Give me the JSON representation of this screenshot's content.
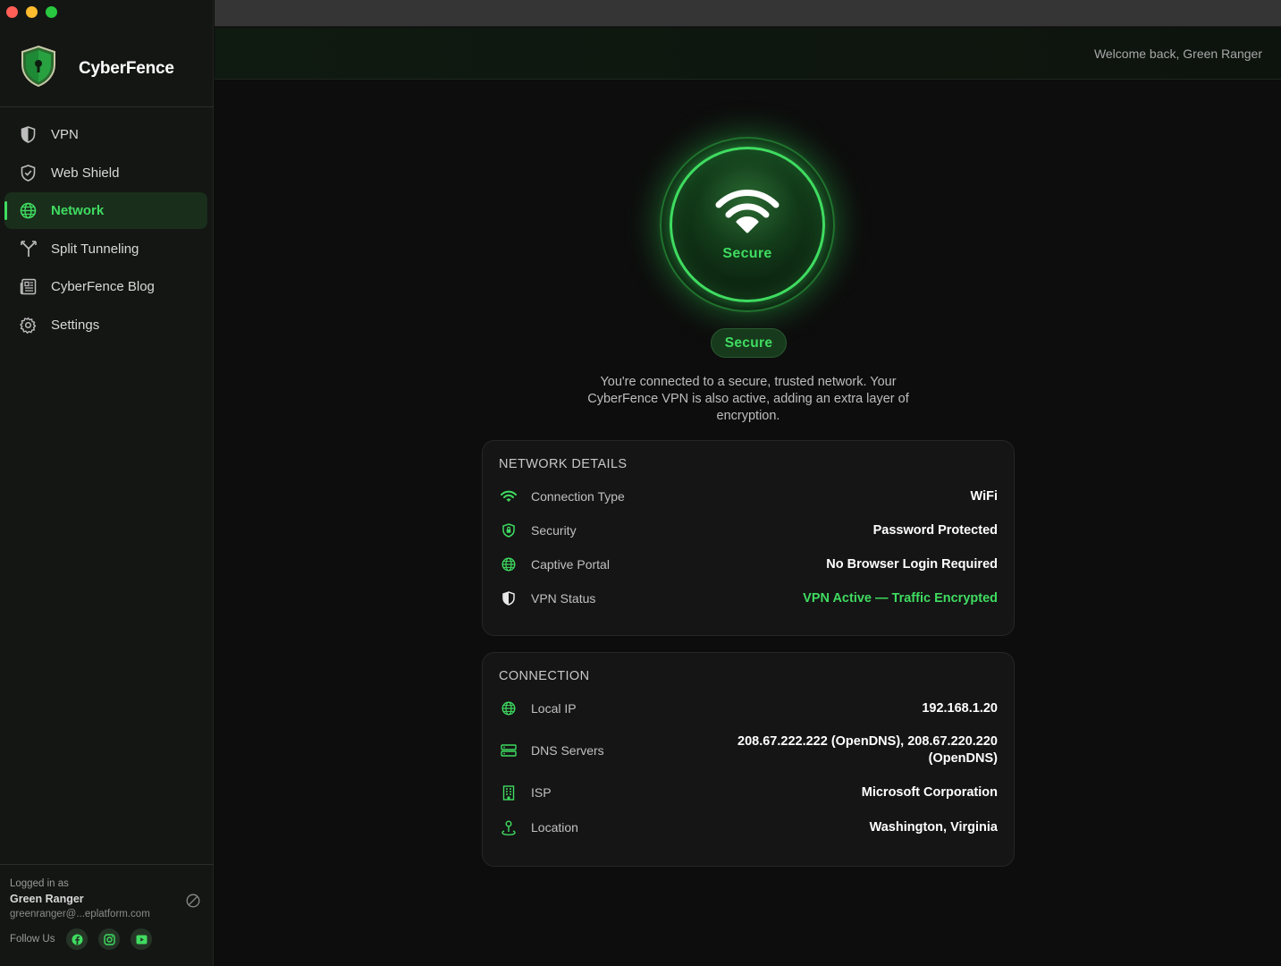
{
  "app": {
    "brand": "CyberFence"
  },
  "colors": {
    "accent": "#3fdc60",
    "background": "#0d0d0d",
    "sidebar": "#141614"
  },
  "sidebar": {
    "items": [
      {
        "label": "VPN",
        "icon": "half-shield-icon"
      },
      {
        "label": "Web Shield",
        "icon": "shield-check-icon"
      },
      {
        "label": "Network",
        "icon": "globe-icon",
        "active": true
      },
      {
        "label": "Split Tunneling",
        "icon": "split-arrow-icon"
      },
      {
        "label": "CyberFence Blog",
        "icon": "newspaper-icon"
      },
      {
        "label": "Settings",
        "icon": "gear-icon"
      }
    ],
    "footer": {
      "logged_label": "Logged in as",
      "user_name": "Green Ranger",
      "email": "greenranger@...eplatform.com",
      "follow_label": "Follow Us"
    }
  },
  "header": {
    "welcome": "Welcome back, Green Ranger"
  },
  "status": {
    "ring_label": "Secure",
    "pill_label": "Secure",
    "description": "You're connected to a secure, trusted network. Your CyberFence VPN is also active, adding an extra layer of encryption."
  },
  "network_details": {
    "title": "NETWORK DETAILS",
    "rows": [
      {
        "label": "Connection Type",
        "value": "WiFi",
        "icon": "wifi-icon"
      },
      {
        "label": "Security",
        "value": "Password Protected",
        "icon": "lock-shield-icon"
      },
      {
        "label": "Captive Portal",
        "value": "No Browser Login Required",
        "icon": "globe-icon"
      },
      {
        "label": "VPN Status",
        "value": "VPN Active — Traffic Encrypted",
        "icon": "half-shield-icon"
      }
    ]
  },
  "connection": {
    "title": "CONNECTION",
    "rows": [
      {
        "label": "Local IP",
        "value": "192.168.1.20",
        "icon": "globe-icon"
      },
      {
        "label": "DNS Servers",
        "value": "208.67.222.222 (OpenDNS), 208.67.220.220 (OpenDNS)",
        "icon": "server-icon"
      },
      {
        "label": "ISP",
        "value": "Microsoft Corporation",
        "icon": "building-icon"
      },
      {
        "label": "Location",
        "value": "Washington, Virginia",
        "icon": "location-pin-icon"
      }
    ]
  }
}
